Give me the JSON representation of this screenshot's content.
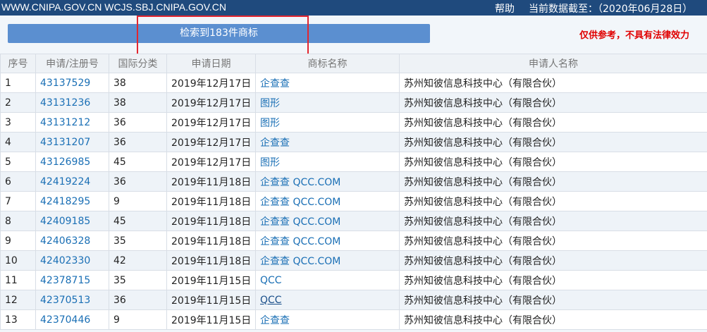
{
  "topbar": {
    "sites": "WWW.CNIPA.GOV.CN WCJS.SBJ.CNIPA.GOV.CN",
    "help": "帮助",
    "data_as_of": "当前数据截至：（2020年06月28日）"
  },
  "result_banner": "检索到183件商标",
  "disclaimer": "仅供参考，不具有法律效力",
  "table": {
    "headers": [
      "序号",
      "申请/注册号",
      "国际分类",
      "申请日期",
      "商标名称",
      "申请人名称"
    ],
    "rows": [
      {
        "no": "1",
        "reg": "43137529",
        "cls": "38",
        "date": "2019年12月17日",
        "name": "企查查",
        "applicant": "苏州知彼信息科技中心（有限合伙）"
      },
      {
        "no": "2",
        "reg": "43131236",
        "cls": "38",
        "date": "2019年12月17日",
        "name": "图形",
        "applicant": "苏州知彼信息科技中心（有限合伙）"
      },
      {
        "no": "3",
        "reg": "43131212",
        "cls": "36",
        "date": "2019年12月17日",
        "name": "图形",
        "applicant": "苏州知彼信息科技中心（有限合伙）"
      },
      {
        "no": "4",
        "reg": "43131207",
        "cls": "36",
        "date": "2019年12月17日",
        "name": "企查查",
        "applicant": "苏州知彼信息科技中心（有限合伙）"
      },
      {
        "no": "5",
        "reg": "43126985",
        "cls": "45",
        "date": "2019年12月17日",
        "name": "图形",
        "applicant": "苏州知彼信息科技中心（有限合伙）"
      },
      {
        "no": "6",
        "reg": "42419224",
        "cls": "36",
        "date": "2019年11月18日",
        "name": "企查查 QCC.COM",
        "applicant": "苏州知彼信息科技中心（有限合伙）"
      },
      {
        "no": "7",
        "reg": "42418295",
        "cls": "9",
        "date": "2019年11月18日",
        "name": "企查查 QCC.COM",
        "applicant": "苏州知彼信息科技中心（有限合伙）"
      },
      {
        "no": "8",
        "reg": "42409185",
        "cls": "45",
        "date": "2019年11月18日",
        "name": "企查查 QCC.COM",
        "applicant": "苏州知彼信息科技中心（有限合伙）"
      },
      {
        "no": "9",
        "reg": "42406328",
        "cls": "35",
        "date": "2019年11月18日",
        "name": "企查查 QCC.COM",
        "applicant": "苏州知彼信息科技中心（有限合伙）"
      },
      {
        "no": "10",
        "reg": "42402330",
        "cls": "42",
        "date": "2019年11月18日",
        "name": "企查查 QCC.COM",
        "applicant": "苏州知彼信息科技中心（有限合伙）"
      },
      {
        "no": "11",
        "reg": "42378715",
        "cls": "35",
        "date": "2019年11月15日",
        "name": "QCC",
        "applicant": "苏州知彼信息科技中心（有限合伙）"
      },
      {
        "no": "12",
        "reg": "42370513",
        "cls": "36",
        "date": "2019年11月15日",
        "name": "QCC",
        "applicant": "苏州知彼信息科技中心（有限合伙）"
      },
      {
        "no": "13",
        "reg": "42370446",
        "cls": "9",
        "date": "2019年11月15日",
        "name": "企查查",
        "applicant": "苏州知彼信息科技中心（有限合伙）"
      }
    ]
  }
}
